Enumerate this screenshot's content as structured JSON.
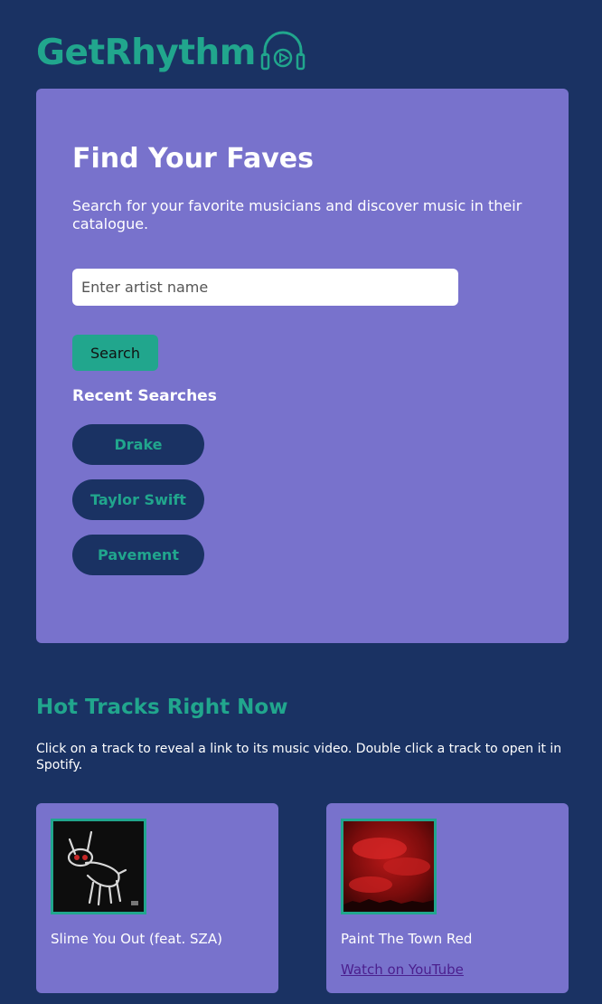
{
  "header": {
    "title": "GetRhythm",
    "logo_icon": "headphones-play-icon"
  },
  "search": {
    "title": "Find Your Faves",
    "description": "Search for your favorite musicians and discover music in their catalogue.",
    "placeholder": "Enter artist name",
    "value": "",
    "button_label": "Search"
  },
  "recent": {
    "title": "Recent Searches",
    "items": [
      {
        "label": "Drake"
      },
      {
        "label": "Taylor Swift"
      },
      {
        "label": "Pavement"
      }
    ]
  },
  "hot": {
    "title": "Hot Tracks Right Now",
    "description": "Click on a track to reveal a link to its music video. Double click a track to open it in Spotify.",
    "tracks": [
      {
        "name": "Slime You Out (feat. SZA)",
        "link": ""
      },
      {
        "name": "Paint The Town Red",
        "link": "Watch on YouTube"
      }
    ]
  },
  "colors": {
    "background": "#1a3263",
    "card": "#7872cc",
    "accent": "#21a68d",
    "link": "#4b1f8e"
  }
}
